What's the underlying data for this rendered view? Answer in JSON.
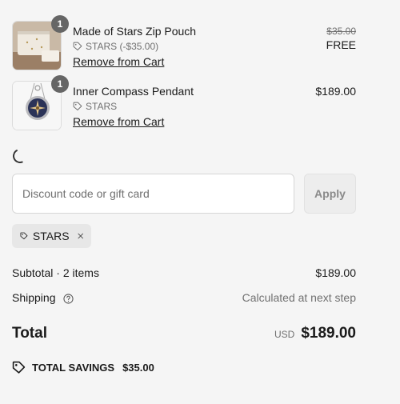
{
  "items": [
    {
      "quantity": "1",
      "name": "Made of Stars Zip Pouch",
      "discount": "STARS (-$35.00)",
      "remove_label": "Remove from Cart",
      "original_price": "$35.00",
      "price": "FREE"
    },
    {
      "quantity": "1",
      "name": "Inner Compass Pendant",
      "discount": "STARS",
      "remove_label": "Remove from Cart",
      "price": "$189.00"
    }
  ],
  "discount_form": {
    "placeholder": "Discount code or gift card",
    "apply_label": "Apply"
  },
  "applied_code": "STARS",
  "summary": {
    "subtotal_label": "Subtotal · 2 items",
    "subtotal_value": "$189.00",
    "shipping_label": "Shipping",
    "shipping_value": "Calculated at next step",
    "total_label": "Total",
    "currency": "USD",
    "total_value": "$189.00"
  },
  "savings": {
    "label": "TOTAL SAVINGS",
    "amount": "$35.00"
  },
  "colors": {
    "background": "#f5f5f5",
    "badge": "#666666",
    "muted_text": "#707070"
  }
}
